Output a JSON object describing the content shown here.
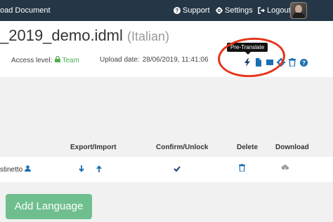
{
  "header": {
    "breadcrumb": "oad Document",
    "support_label": "Support",
    "settings_label": "Settings",
    "logout_label": "Logout"
  },
  "document": {
    "title": "_2019_demo.idml",
    "language": "(Italian)",
    "access_label": "Access level:",
    "access_value": "Team",
    "upload_label": "Upload date:",
    "upload_value": "28/06/2019, 11:41:06"
  },
  "tooltip": {
    "text": "Pre-Translate"
  },
  "actions": [
    "lightning-icon",
    "document-icon",
    "book-icon",
    "gear-icon",
    "trash-icon",
    "help-icon"
  ],
  "table": {
    "headers": {
      "export_import": "Export/Import",
      "confirm_unlock": "Confirm/Unlock",
      "delete": "Delete",
      "download": "Download"
    },
    "rows": [
      {
        "assignee": "stinetto"
      }
    ]
  },
  "buttons": {
    "add_language": "Add Language"
  },
  "colors": {
    "navbar": "#253746",
    "accent_blue": "#1a6fb0",
    "team_green": "#4caf50",
    "highlight_red": "#e63319",
    "add_button": "#6fbf8e"
  }
}
